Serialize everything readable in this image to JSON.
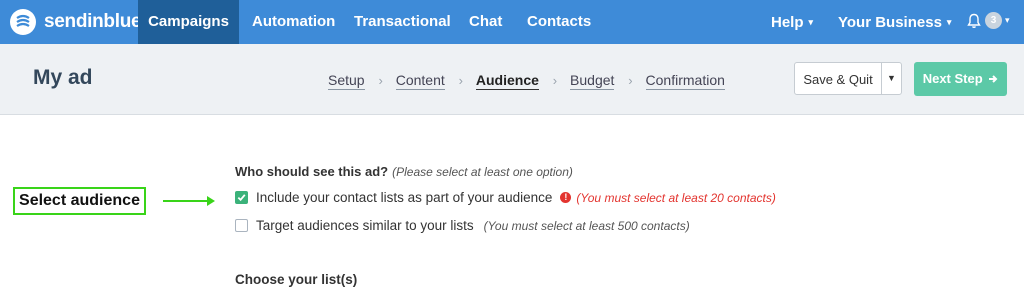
{
  "brand": {
    "name": "sendinblue",
    "logo_icon": "sendinblue-logo-icon"
  },
  "nav": {
    "items": [
      {
        "label": "Campaigns",
        "active": true
      },
      {
        "label": "Automation",
        "active": false
      },
      {
        "label": "Transactional",
        "active": false
      },
      {
        "label": "Chat",
        "active": false
      },
      {
        "label": "Contacts",
        "active": false
      }
    ],
    "help": "Help",
    "business": "Your Business",
    "notifications": {
      "icon": "bell-icon",
      "count": "3"
    }
  },
  "header": {
    "title": "My ad",
    "steps": [
      {
        "label": "Setup",
        "current": false
      },
      {
        "label": "Content",
        "current": false
      },
      {
        "label": "Audience",
        "current": true
      },
      {
        "label": "Budget",
        "current": false
      },
      {
        "label": "Confirmation",
        "current": false
      }
    ],
    "save_label": "Save & Quit",
    "next_label": "Next Step"
  },
  "annotation": {
    "label": "Select audience"
  },
  "audience": {
    "question": "Who should see this ad?",
    "question_hint": "(Please select at least one option)",
    "options": [
      {
        "label": "Include your contact lists as part of your audience",
        "checked": true,
        "error": "(You must select at least 20 contacts)"
      },
      {
        "label": "Target audiences similar to your lists",
        "checked": false,
        "note": "(You must select at least 500 contacts)"
      }
    ],
    "lists_title": "Choose your list(s)"
  },
  "colors": {
    "nav_bg": "#3e8bd8",
    "nav_active": "#1f5f99",
    "next_button": "#5cc9a7",
    "error": "#e3342f",
    "checkbox": "#3bb27a",
    "annotation": "#39d419"
  }
}
